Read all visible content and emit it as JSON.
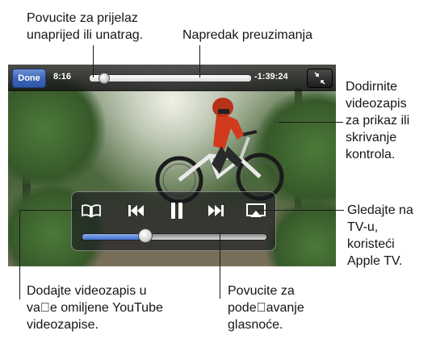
{
  "player": {
    "done_label": "Done",
    "elapsed_time": "8:16",
    "remaining_time": "-1:39:24",
    "playback_progress": 0.09,
    "buffered_progress": 1.0,
    "volume_level": 0.34
  },
  "icons": {
    "bookmark": "bookmark-book-icon",
    "previous": "skip-back-icon",
    "pause": "pause-icon",
    "next": "skip-forward-icon",
    "airplay": "airplay-icon",
    "fullscreen": "exit-fullscreen-icon"
  },
  "colors": {
    "done_button": "#3a63b8",
    "volume_fill": "#3f6fd1"
  },
  "callouts": {
    "scrub": [
      "Povucite za prijelaz",
      "unaprijed ili unatrag."
    ],
    "download": [
      "Napredak preuzimanja"
    ],
    "tap": [
      "Dodirnite",
      "videozapis",
      "za prikaz ili",
      "skrivanje",
      "kontrola."
    ],
    "tv": [
      "Gledajte na",
      "TV-u,",
      "koristeći",
      "Apple TV."
    ],
    "favorites": [
      "Dodajte videozapis u",
      "va\u0000e omiljene YouTube",
      "videozapise."
    ],
    "volume": [
      "Povucite za",
      "pode\u0000avanje",
      "glasnoće."
    ]
  }
}
